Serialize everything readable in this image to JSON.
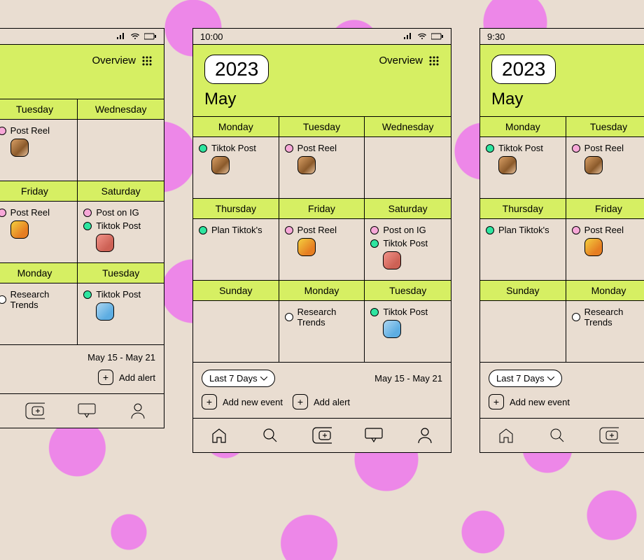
{
  "status": {
    "time_center": "10:00",
    "time_right": "9:30"
  },
  "header": {
    "year": "2023",
    "month": "May",
    "overview_label": "Overview"
  },
  "days_row1": [
    "Monday",
    "Tuesday",
    "Wednesday"
  ],
  "days_row2": [
    "Thursday",
    "Friday",
    "Saturday"
  ],
  "days_row3": [
    "Sunday",
    "Monday",
    "Tuesday"
  ],
  "events": {
    "mon1": {
      "label": "Tiktok Post",
      "color": "green",
      "thumb": "brown"
    },
    "tue1": {
      "label": "Post Reel",
      "color": "pink",
      "thumb": "brown"
    },
    "thu": {
      "label": "Plan Tiktok's",
      "color": "green"
    },
    "fri": {
      "label": "Post Reel",
      "color": "pink",
      "thumb": "yellow"
    },
    "sat_a": {
      "label": "Post on IG",
      "color": "pink"
    },
    "sat_b": {
      "label": "Tiktok Post",
      "color": "green",
      "thumb": "rose"
    },
    "mon2": {
      "label": "Research Trends",
      "color": "white"
    },
    "tue2": {
      "label": "Tiktok Post",
      "color": "green",
      "thumb": "blue"
    }
  },
  "footer": {
    "range_label": "Last 7 Days",
    "date_range": "May 15 - May 21",
    "add_event": "Add new event",
    "add_alert": "Add alert"
  }
}
